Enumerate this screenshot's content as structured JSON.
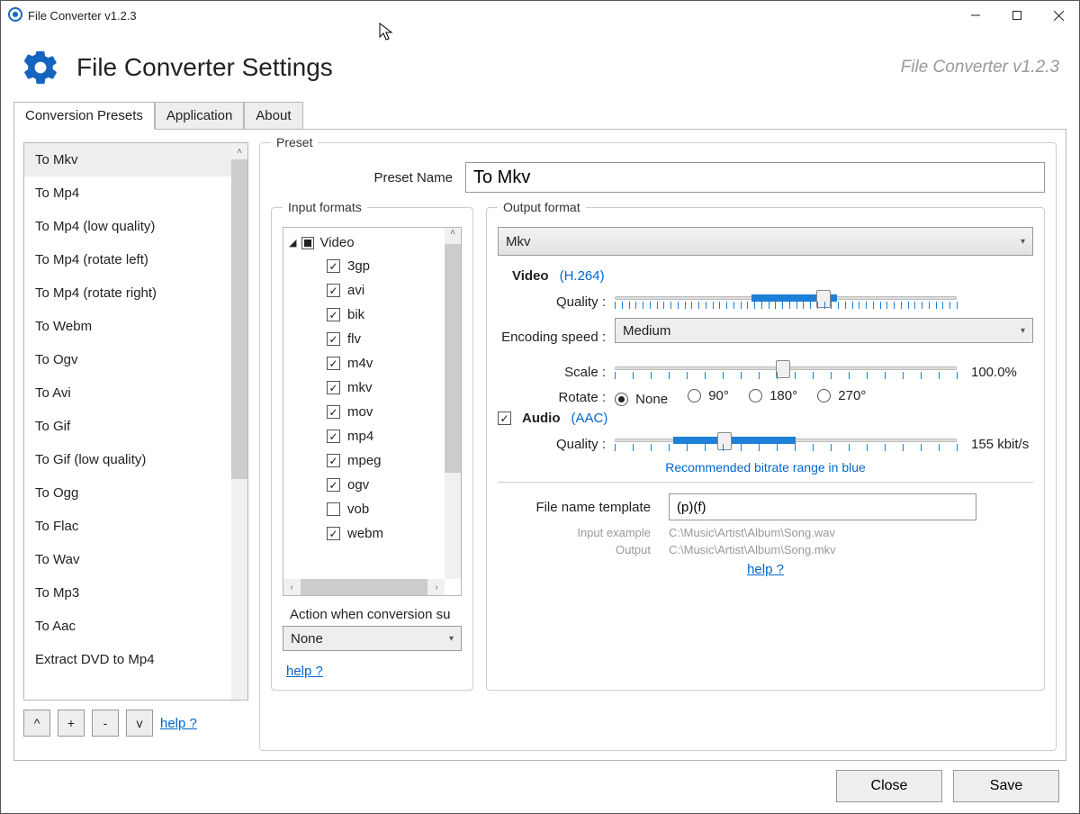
{
  "window": {
    "title": "File Converter v1.2.3"
  },
  "header": {
    "title": "File Converter Settings",
    "version": "File Converter v1.2.3"
  },
  "tabs": {
    "t0": "Conversion Presets",
    "t1": "Application",
    "t2": "About"
  },
  "presets": {
    "items": [
      "To Mkv",
      "To Mp4",
      "To Mp4 (low quality)",
      "To Mp4 (rotate left)",
      "To Mp4 (rotate right)",
      "To Webm",
      "To Ogv",
      "To Avi",
      "To Gif",
      "To Gif (low quality)",
      "To Ogg",
      "To Flac",
      "To Wav",
      "To Mp3",
      "To Aac",
      "Extract DVD to Mp4"
    ],
    "selectedIndex": 0,
    "help": "help ?",
    "btn_up": "^",
    "btn_add": "+",
    "btn_remove": "-",
    "btn_down": "v"
  },
  "preset_panel": {
    "legend": "Preset",
    "name_label": "Preset Name",
    "name_value": "To Mkv",
    "input_formats": {
      "legend": "Input formats",
      "parent": "Video",
      "items": [
        {
          "name": "3gp",
          "checked": true
        },
        {
          "name": "avi",
          "checked": true
        },
        {
          "name": "bik",
          "checked": true
        },
        {
          "name": "flv",
          "checked": true
        },
        {
          "name": "m4v",
          "checked": true
        },
        {
          "name": "mkv",
          "checked": true
        },
        {
          "name": "mov",
          "checked": true
        },
        {
          "name": "mp4",
          "checked": true
        },
        {
          "name": "mpeg",
          "checked": true
        },
        {
          "name": "ogv",
          "checked": true
        },
        {
          "name": "vob",
          "checked": false
        },
        {
          "name": "webm",
          "checked": true
        }
      ],
      "action_label": "Action when conversion su",
      "action_value": "None",
      "help": "help ?"
    },
    "output": {
      "legend": "Output format",
      "format_value": "Mkv",
      "video_label": "Video",
      "video_codec": "(H.264)",
      "quality_label": "Quality :",
      "encoding_label": "Encoding speed :",
      "encoding_value": "Medium",
      "scale_label": "Scale :",
      "scale_value": "100.0%",
      "rotate_label": "Rotate :",
      "rotate_options": [
        "None",
        "90°",
        "180°",
        "270°"
      ],
      "rotate_selected": 0,
      "audio_label": "Audio",
      "audio_codec": "(AAC)",
      "audio_checked": true,
      "audio_quality_label": "Quality :",
      "audio_quality_value": "155 kbit/s",
      "rec_note": "Recommended bitrate range in blue",
      "tmpl_label": "File name template",
      "tmpl_value": "(p)(f)",
      "input_ex_label": "Input example",
      "input_ex_value": "C:\\Music\\Artist\\Album\\Song.wav",
      "output_ex_label": "Output",
      "output_ex_value": "C:\\Music\\Artist\\Album\\Song.mkv",
      "help": "help ?"
    }
  },
  "footer": {
    "close": "Close",
    "save": "Save"
  }
}
